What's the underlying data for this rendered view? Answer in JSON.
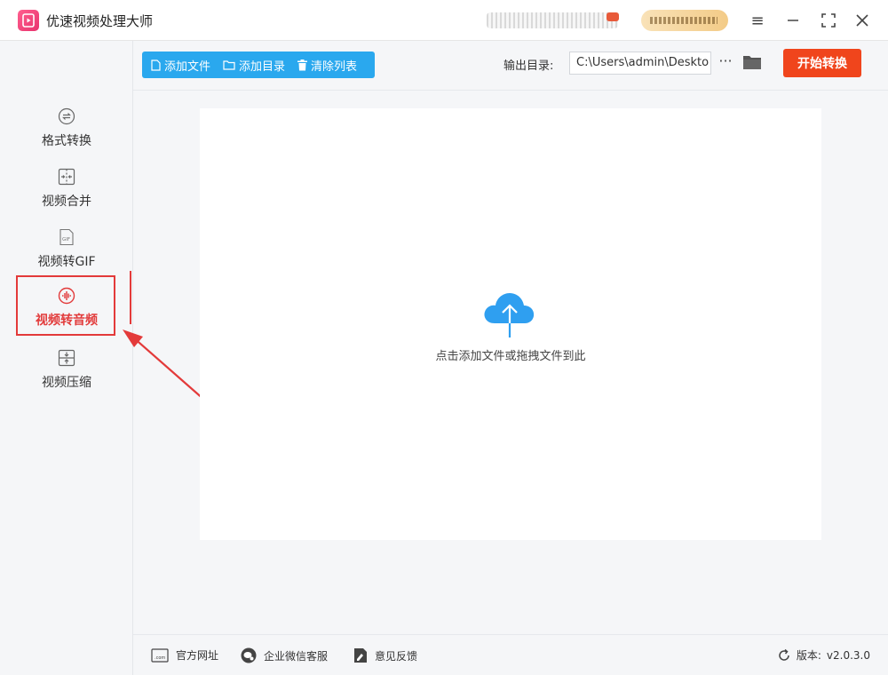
{
  "app": {
    "title": "优速视频处理大师",
    "accent_color": "#2aa8ee",
    "start_color": "#f0451c",
    "highlight_color": "#e33a3a"
  },
  "window_controls": {
    "menu": "≡",
    "minimize": "—",
    "maximize": "⛶",
    "close": "✕"
  },
  "sidebar": {
    "items": [
      {
        "label": "格式转换",
        "icon": "format-convert-icon",
        "active": false
      },
      {
        "label": "视频合并",
        "icon": "video-merge-icon",
        "active": false
      },
      {
        "label": "视频转GIF",
        "icon": "gif-icon",
        "active": false
      },
      {
        "label": "视频转音频",
        "icon": "audio-icon",
        "active": true
      },
      {
        "label": "视频压缩",
        "icon": "compress-icon",
        "active": false
      }
    ]
  },
  "toolbar": {
    "add_file": "添加文件",
    "add_folder": "添加目录",
    "clear_list": "清除列表",
    "output_label": "输出目录:",
    "output_path": "C:\\Users\\admin\\Deskto",
    "more": "···",
    "start": "开始转换"
  },
  "drop_area": {
    "hint": "点击添加文件或拖拽文件到此"
  },
  "footer": {
    "website": "官方网址",
    "wechat_support": "企业微信客服",
    "feedback": "意见反馈",
    "version_label": "版本:",
    "version": "v2.0.3.0"
  }
}
